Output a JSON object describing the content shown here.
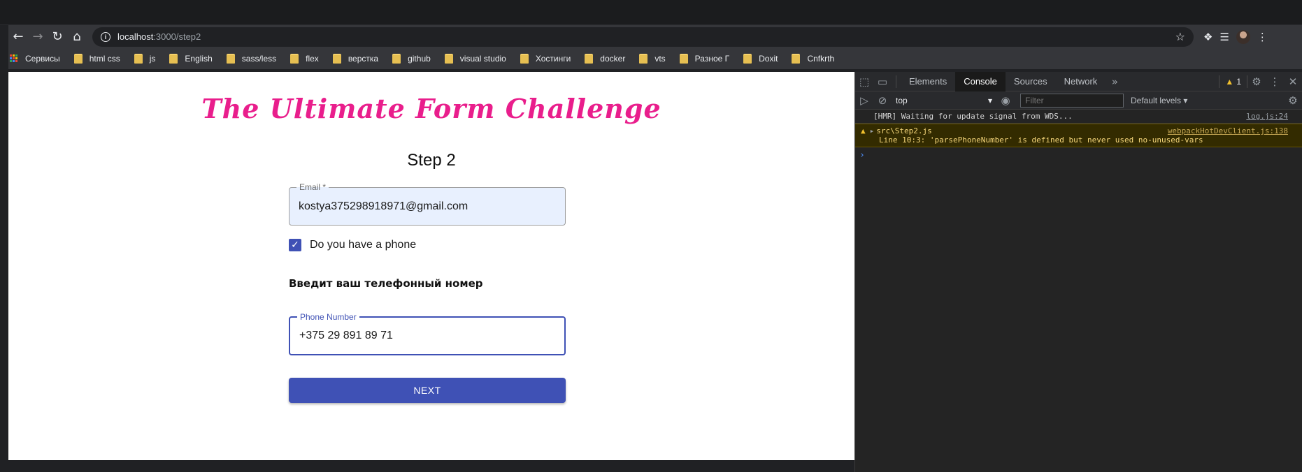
{
  "browser": {
    "url_host": "localhost",
    "url_path": ":3000/step2"
  },
  "bookmarks": [
    {
      "label": "Сервисы",
      "type": "apps"
    },
    {
      "label": "html css",
      "type": "folder"
    },
    {
      "label": "js",
      "type": "folder"
    },
    {
      "label": "English",
      "type": "folder"
    },
    {
      "label": "sass/less",
      "type": "folder"
    },
    {
      "label": "flex",
      "type": "folder"
    },
    {
      "label": "верстка",
      "type": "folder"
    },
    {
      "label": "github",
      "type": "folder"
    },
    {
      "label": "visual studio",
      "type": "folder"
    },
    {
      "label": "Хостинги",
      "type": "folder"
    },
    {
      "label": "docker",
      "type": "folder"
    },
    {
      "label": "vts",
      "type": "folder"
    },
    {
      "label": "Разное Г",
      "type": "folder"
    },
    {
      "label": "Doxit",
      "type": "folder"
    },
    {
      "label": "Cnfkrth",
      "type": "folder"
    }
  ],
  "page": {
    "app_title": "The Ultimate Form Challenge",
    "step_title": "Step 2",
    "email": {
      "label": "Email *",
      "value": "kostya375298918971@gmail.com"
    },
    "has_phone": {
      "label": "Do you have a phone",
      "checked": true
    },
    "phone_hint": "Введит ваш телефонный номер",
    "phone": {
      "label": "Phone Number",
      "value": "+375 29 891 89 71"
    },
    "next_label": "NEXT",
    "accent_color": "#3f51b5",
    "title_color": "#e91e8c"
  },
  "devtools": {
    "tabs": [
      "Elements",
      "Console",
      "Sources",
      "Network"
    ],
    "active_tab": "Console",
    "warning_count": "1",
    "context": "top",
    "filter_placeholder": "Filter",
    "levels": "Default levels",
    "logs": [
      {
        "text": "[HMR] Waiting for update signal from WDS...",
        "source": "log.js:24"
      }
    ],
    "warning": {
      "file": "src\\Step2.js",
      "source": "webpackHotDevClient.js:138",
      "message": "Line 10:3:  'parsePhoneNumber' is defined but never used  no-unused-vars"
    }
  }
}
